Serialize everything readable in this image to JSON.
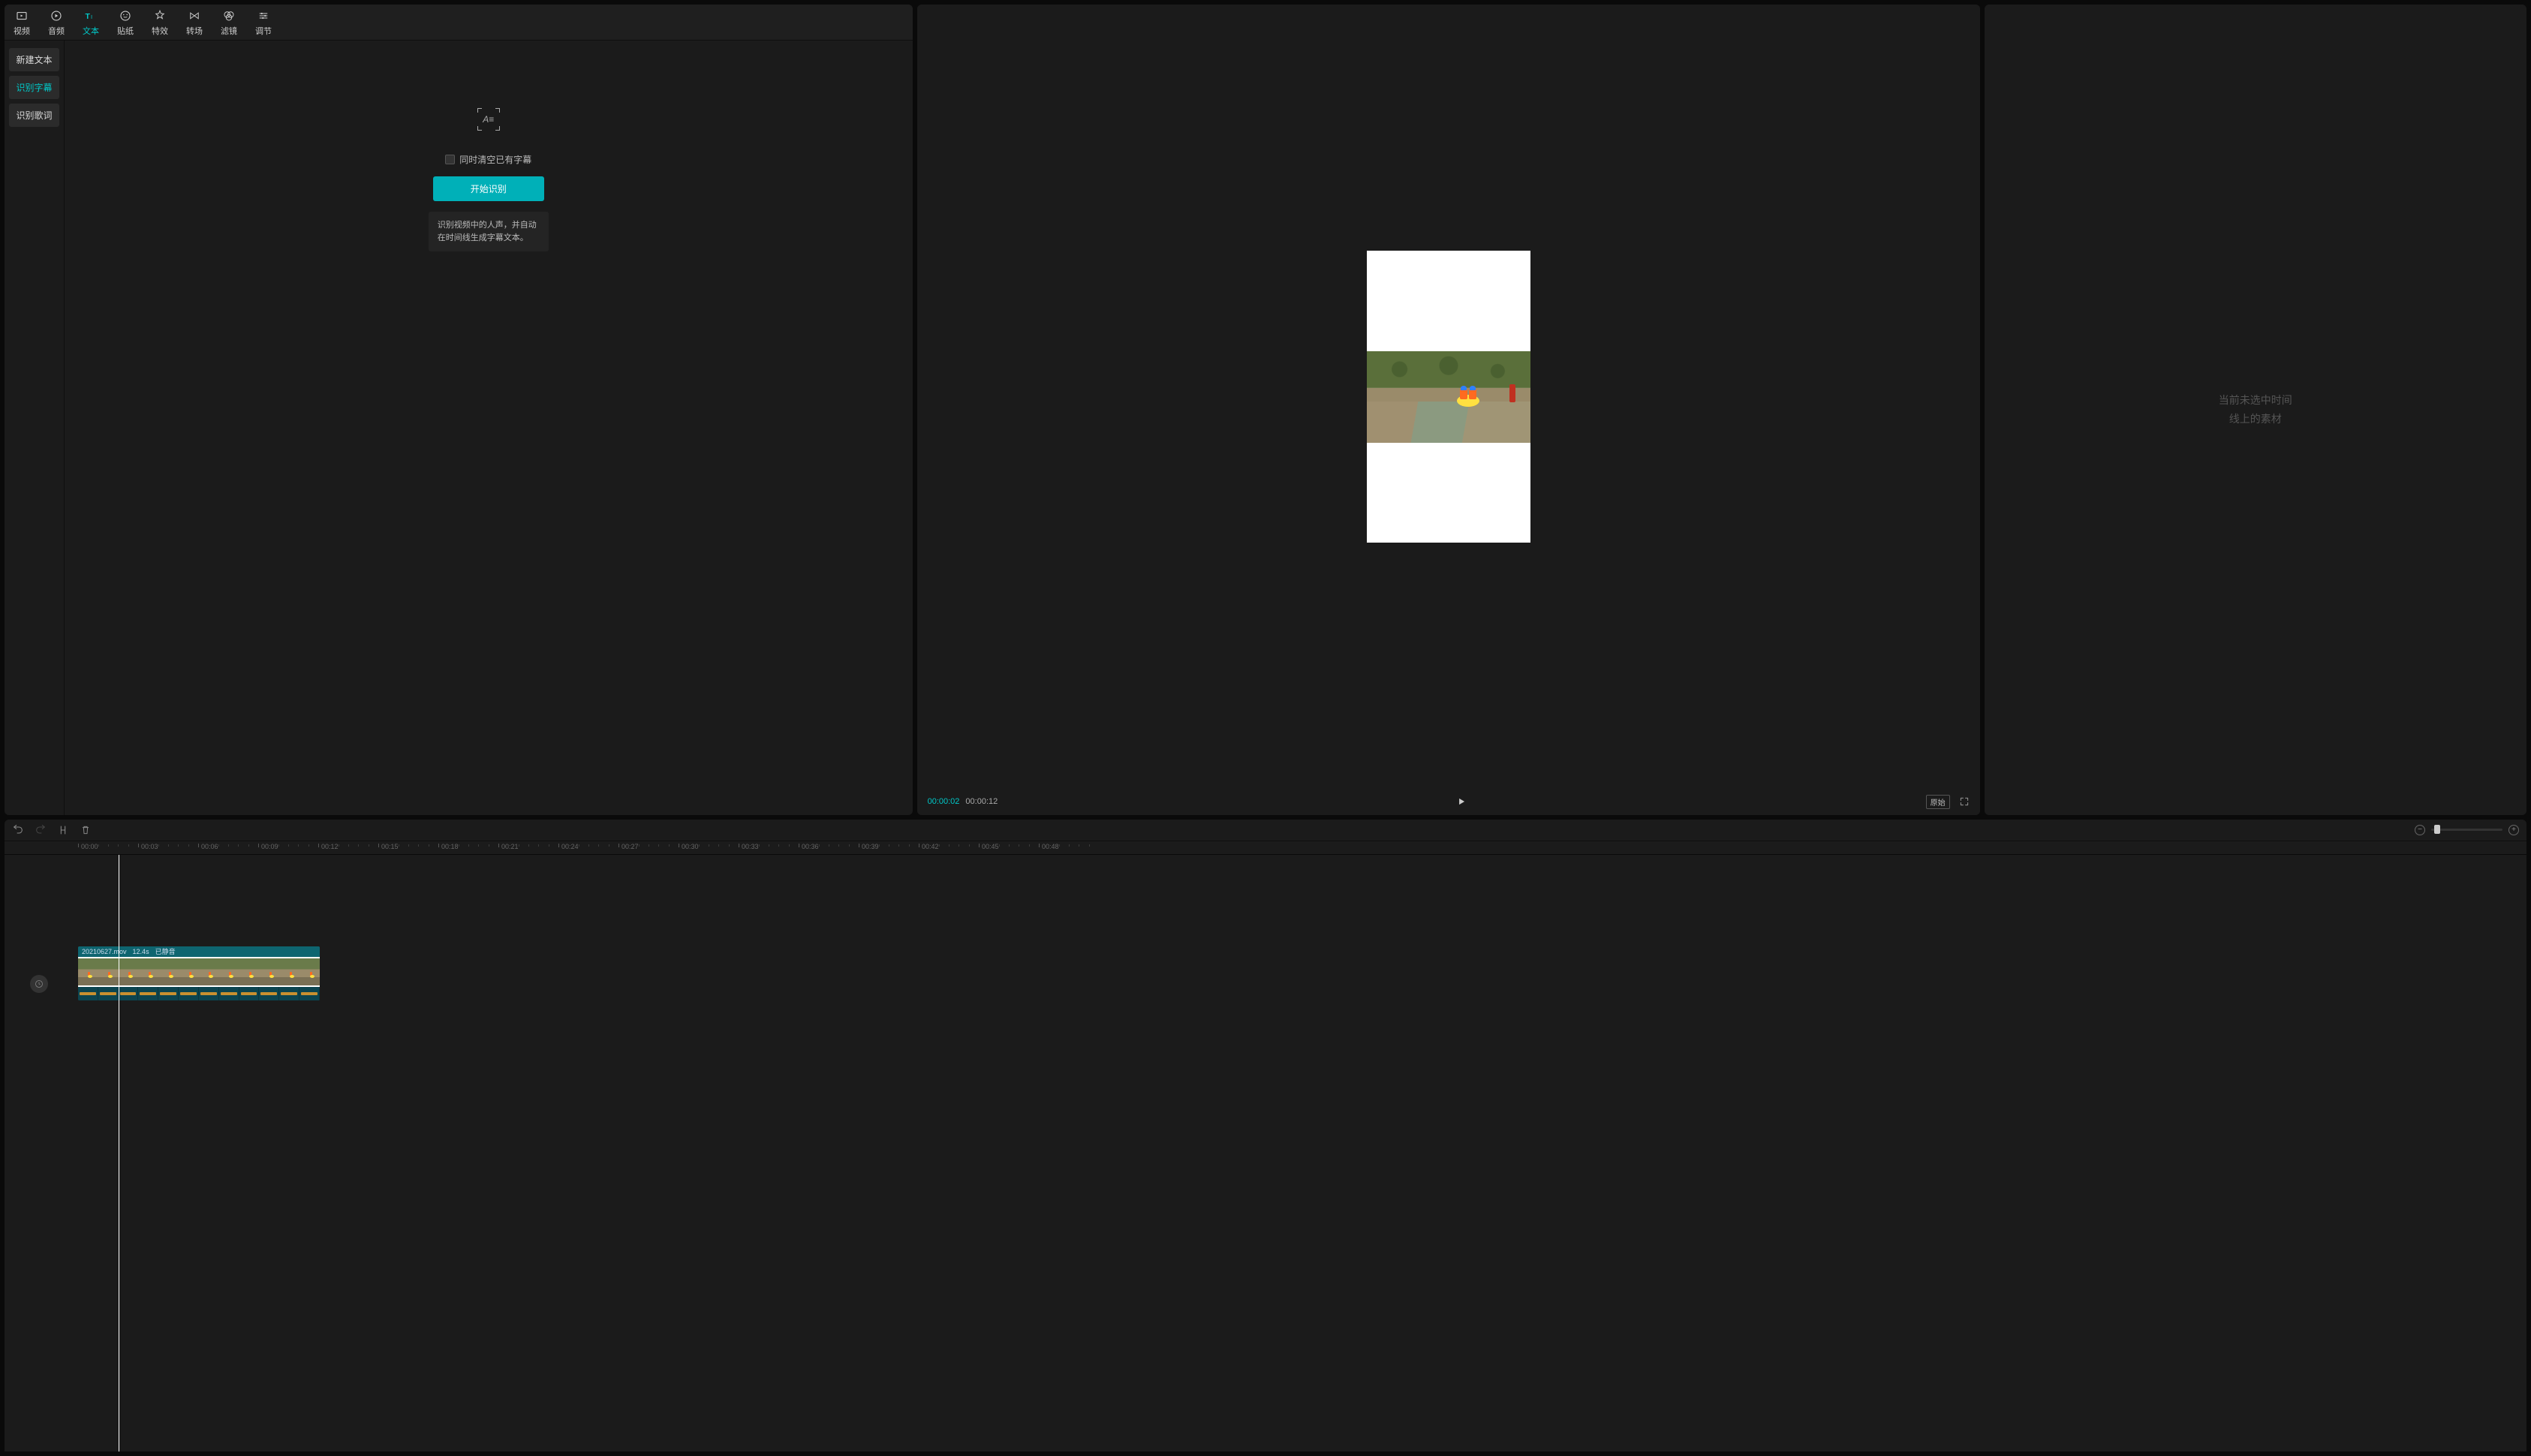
{
  "categoryTabs": [
    {
      "label": "视频",
      "name": "cat-video"
    },
    {
      "label": "音频",
      "name": "cat-audio"
    },
    {
      "label": "文本",
      "name": "cat-text"
    },
    {
      "label": "贴纸",
      "name": "cat-sticker"
    },
    {
      "label": "特效",
      "name": "cat-effect"
    },
    {
      "label": "转场",
      "name": "cat-transition"
    },
    {
      "label": "滤镜",
      "name": "cat-filter"
    },
    {
      "label": "调节",
      "name": "cat-adjust"
    }
  ],
  "activeCategoryIndex": 2,
  "textSubTabs": {
    "newText": "新建文本",
    "recognizeSubtitle": "识别字幕",
    "recognizeLyrics": "识别歌词"
  },
  "activeSubTab": "recognizeSubtitle",
  "subtitleOptions": {
    "clearExistingLabel": "同时清空已有字幕",
    "clearExistingChecked": false,
    "startButton": "开始识别",
    "description": "识别视频中的人声，并自动在时间线生成字幕文本。",
    "iconGlyph": "A≡"
  },
  "preview": {
    "currentTime": "00:00:02",
    "totalTime": "00:00:12",
    "ratioLabel": "原始"
  },
  "rightPanel": {
    "emptyLine1": "当前未选中时间",
    "emptyLine2": "线上的素材"
  },
  "timeline": {
    "ticks": [
      "00:00",
      "00:03",
      "00:06",
      "00:09",
      "00:12",
      "00:15",
      "00:18",
      "00:21",
      "00:24",
      "00:27",
      "00:30",
      "00:33",
      "00:36",
      "00:39",
      "00:42",
      "00:45",
      "00:48"
    ],
    "clip": {
      "filename": "20210627.mov",
      "duration": "12.4s",
      "muteLabel": "已静音"
    }
  }
}
